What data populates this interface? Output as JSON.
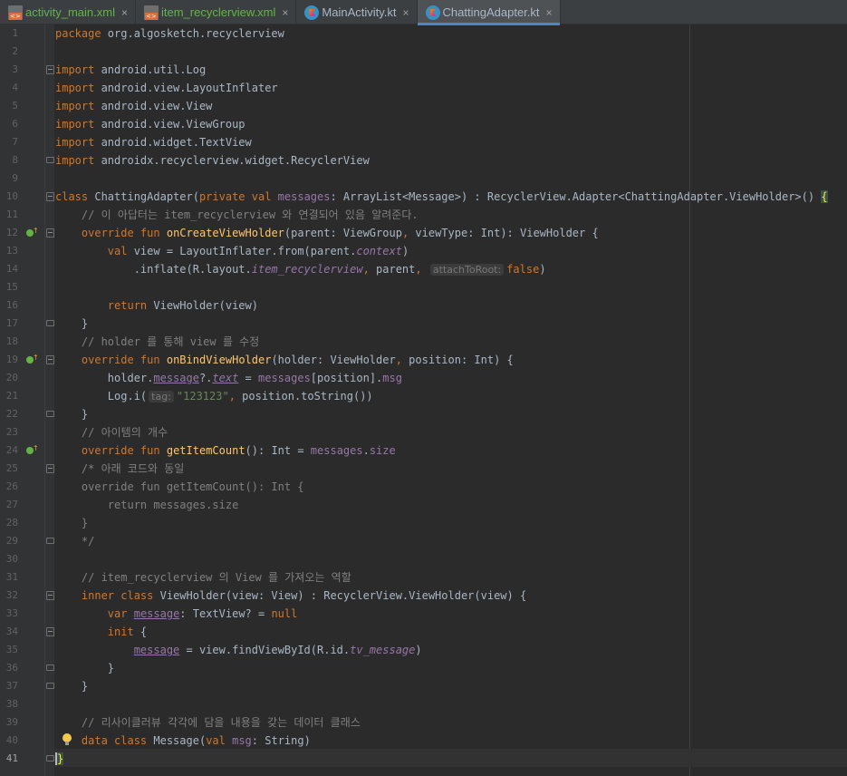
{
  "tabs": [
    {
      "label": "activity_main.xml",
      "icon": "xml-file-icon",
      "color": "#62b543",
      "active": false
    },
    {
      "label": "item_recyclerview.xml",
      "icon": "xml-file-icon",
      "color": "#62b543",
      "active": false
    },
    {
      "label": "MainActivity.kt",
      "icon": "kotlin-file-icon",
      "color": "#a9b7c6",
      "active": false
    },
    {
      "label": "ChattingAdapter.kt",
      "icon": "kotlin-file-icon",
      "color": "#a9b7c6",
      "active": true
    }
  ],
  "tab_close_glyph": "×",
  "current_line": 41,
  "lines": [
    {
      "n": "1",
      "parts": [
        [
          "package",
          "kw"
        ],
        [
          " org.algosketch.recyclerview",
          ""
        ]
      ]
    },
    {
      "n": "2",
      "parts": []
    },
    {
      "n": "3",
      "fold": "minus",
      "parts": [
        [
          "import",
          "kw"
        ],
        [
          " android.util.Log",
          ""
        ]
      ]
    },
    {
      "n": "4",
      "parts": [
        [
          "import",
          "kw"
        ],
        [
          " android.view.LayoutInflater",
          ""
        ]
      ]
    },
    {
      "n": "5",
      "parts": [
        [
          "import",
          "kw"
        ],
        [
          " android.view.View",
          ""
        ]
      ]
    },
    {
      "n": "6",
      "parts": [
        [
          "import",
          "kw"
        ],
        [
          " android.view.ViewGroup",
          ""
        ]
      ]
    },
    {
      "n": "7",
      "parts": [
        [
          "import",
          "kw"
        ],
        [
          " android.widget.TextView",
          ""
        ]
      ]
    },
    {
      "n": "8",
      "fold": "end",
      "parts": [
        [
          "import",
          "kw"
        ],
        [
          " androidx.recyclerview.widget.RecyclerView",
          ""
        ]
      ]
    },
    {
      "n": "9",
      "parts": []
    },
    {
      "n": "10",
      "fold": "minus",
      "parts": [
        [
          "class",
          "kw"
        ],
        [
          " ChattingAdapter(",
          ""
        ],
        [
          "private val",
          "kw"
        ],
        [
          " ",
          ""
        ],
        [
          "messages",
          "prop"
        ],
        [
          ": ArrayList<Message>) : RecyclerView.Adapter<ChattingAdapter.ViewHolder>() ",
          ""
        ],
        [
          "{",
          "brace-hl"
        ]
      ]
    },
    {
      "n": "11",
      "parts": [
        [
          "    // 이 아답터는 item_recyclerview 와 연결되어 있음 알려준다.",
          "cm"
        ]
      ]
    },
    {
      "n": "12",
      "fold": "minus",
      "run": true,
      "parts": [
        [
          "    ",
          ""
        ],
        [
          "override fun",
          "kw"
        ],
        [
          " ",
          ""
        ],
        [
          "onCreateViewHolder",
          "fn"
        ],
        [
          "(parent: ViewGroup",
          ""
        ],
        [
          ",",
          "kw"
        ],
        [
          " viewType: Int): ViewHolder {",
          ""
        ]
      ]
    },
    {
      "n": "13",
      "parts": [
        [
          "        ",
          ""
        ],
        [
          "val",
          "kw"
        ],
        [
          " view = LayoutInflater.from(parent.",
          ""
        ],
        [
          "context",
          "prop it"
        ],
        [
          ")",
          ""
        ]
      ]
    },
    {
      "n": "14",
      "parts": [
        [
          "            .inflate(R.layout.",
          ""
        ],
        [
          "item_recyclerview",
          "prop it"
        ],
        [
          ",",
          "kw"
        ],
        [
          " parent",
          ""
        ],
        [
          ",",
          "kw"
        ],
        [
          " ",
          ""
        ],
        [
          "attachToRoot:",
          "hint"
        ],
        [
          "false",
          "kw"
        ],
        [
          ")",
          ""
        ]
      ]
    },
    {
      "n": "15",
      "parts": []
    },
    {
      "n": "16",
      "parts": [
        [
          "        ",
          ""
        ],
        [
          "return",
          "kw"
        ],
        [
          " ViewHolder(view)",
          ""
        ]
      ]
    },
    {
      "n": "17",
      "fold": "end",
      "parts": [
        [
          "    }",
          ""
        ]
      ]
    },
    {
      "n": "18",
      "parts": [
        [
          "    // holder 를 통해 view 를 수정",
          "cm"
        ]
      ]
    },
    {
      "n": "19",
      "fold": "minus",
      "run": true,
      "parts": [
        [
          "    ",
          ""
        ],
        [
          "override fun",
          "kw"
        ],
        [
          " ",
          ""
        ],
        [
          "onBindViewHolder",
          "fn"
        ],
        [
          "(holder: ViewHolder",
          ""
        ],
        [
          ",",
          "kw"
        ],
        [
          " position: Int) {",
          ""
        ]
      ]
    },
    {
      "n": "20",
      "parts": [
        [
          "        holder.",
          ""
        ],
        [
          "message",
          "prop ul"
        ],
        [
          "?.",
          ""
        ],
        [
          "text",
          "prop it ul"
        ],
        [
          " = ",
          ""
        ],
        [
          "messages",
          "prop"
        ],
        [
          "[position].",
          ""
        ],
        [
          "msg",
          "prop"
        ]
      ]
    },
    {
      "n": "21",
      "parts": [
        [
          "        Log.i(",
          ""
        ],
        [
          "tag:",
          "hint"
        ],
        [
          "\"123123\"",
          "str"
        ],
        [
          ",",
          "kw"
        ],
        [
          " position.toString())",
          ""
        ]
      ]
    },
    {
      "n": "22",
      "fold": "end",
      "parts": [
        [
          "    }",
          ""
        ]
      ]
    },
    {
      "n": "23",
      "parts": [
        [
          "    // 아이템의 개수",
          "cm"
        ]
      ]
    },
    {
      "n": "24",
      "run": true,
      "parts": [
        [
          "    ",
          ""
        ],
        [
          "override fun",
          "kw"
        ],
        [
          " ",
          ""
        ],
        [
          "getItemCount",
          "fn"
        ],
        [
          "(): Int = ",
          ""
        ],
        [
          "messages",
          "prop"
        ],
        [
          ".",
          ""
        ],
        [
          "size",
          "prop"
        ]
      ]
    },
    {
      "n": "25",
      "fold": "minus",
      "parts": [
        [
          "    /* 아래 코드와 동일",
          "cm"
        ]
      ]
    },
    {
      "n": "26",
      "parts": [
        [
          "    override fun getItemCount(): Int {",
          "cm"
        ]
      ]
    },
    {
      "n": "27",
      "parts": [
        [
          "        return messages.size",
          "cm"
        ]
      ]
    },
    {
      "n": "28",
      "parts": [
        [
          "    }",
          "cm"
        ]
      ]
    },
    {
      "n": "29",
      "fold": "end",
      "parts": [
        [
          "    */",
          "cm"
        ]
      ]
    },
    {
      "n": "30",
      "parts": []
    },
    {
      "n": "31",
      "parts": [
        [
          "    // item_recyclerview 의 View 를 가져오는 역할",
          "cm"
        ]
      ]
    },
    {
      "n": "32",
      "fold": "minus",
      "parts": [
        [
          "    ",
          ""
        ],
        [
          "inner class",
          "kw"
        ],
        [
          " ViewHolder(view: View) : RecyclerView.ViewHolder(view) {",
          ""
        ]
      ]
    },
    {
      "n": "33",
      "parts": [
        [
          "        ",
          ""
        ],
        [
          "var",
          "kw"
        ],
        [
          " ",
          ""
        ],
        [
          "message",
          "prop ul"
        ],
        [
          ": TextView? = ",
          ""
        ],
        [
          "null",
          "kw"
        ]
      ]
    },
    {
      "n": "34",
      "fold": "minus",
      "parts": [
        [
          "        ",
          ""
        ],
        [
          "init",
          "kw"
        ],
        [
          " {",
          ""
        ]
      ]
    },
    {
      "n": "35",
      "parts": [
        [
          "            ",
          ""
        ],
        [
          "message",
          "prop ul"
        ],
        [
          " = view.findViewById(R.id.",
          ""
        ],
        [
          "tv_message",
          "prop it"
        ],
        [
          ")",
          ""
        ]
      ]
    },
    {
      "n": "36",
      "fold": "end",
      "parts": [
        [
          "        }",
          ""
        ]
      ]
    },
    {
      "n": "37",
      "fold": "end",
      "parts": [
        [
          "    }",
          ""
        ]
      ]
    },
    {
      "n": "38",
      "parts": []
    },
    {
      "n": "39",
      "parts": [
        [
          "    // 리사이클러뷰 각각에 담을 내용을 갖는 데이터 클래스",
          "cm"
        ]
      ]
    },
    {
      "n": "40",
      "bulb": true,
      "parts": [
        [
          "    ",
          ""
        ],
        [
          "data class",
          "kw"
        ],
        [
          " Message(",
          ""
        ],
        [
          "val",
          "kw"
        ],
        [
          " ",
          ""
        ],
        [
          "msg",
          "prop"
        ],
        [
          ": String)",
          ""
        ]
      ]
    },
    {
      "n": "41",
      "fold": "end",
      "caret": true,
      "parts": [
        [
          "}",
          "brace-hl"
        ]
      ]
    }
  ]
}
